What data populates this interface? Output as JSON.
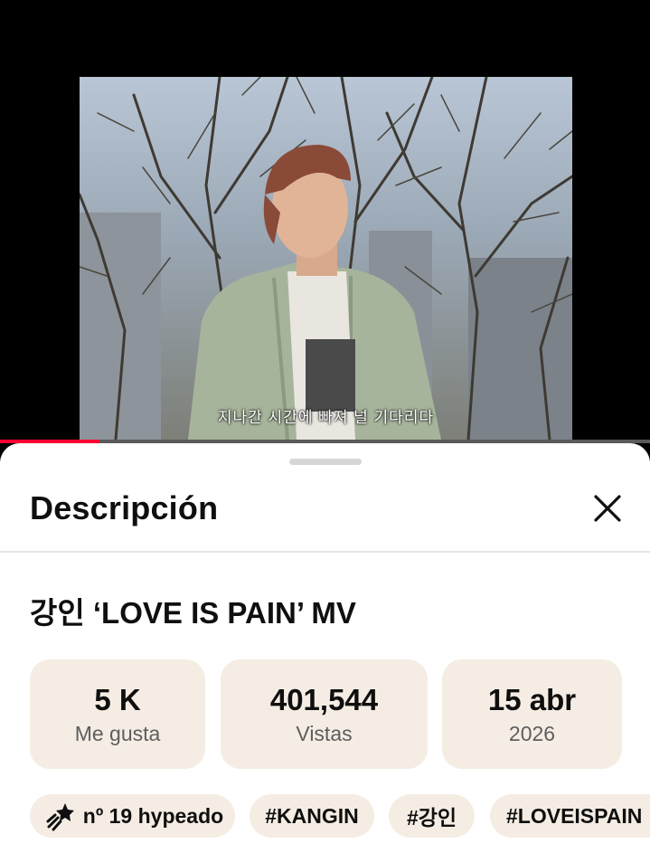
{
  "video": {
    "subtitle": "지나간 시간에 빠져 널 기다리다",
    "progress_fraction": 0.153
  },
  "sheet": {
    "title": "Descripción",
    "close_icon": "close-icon"
  },
  "description": {
    "video_title": "강인 ‘LOVE IS PAIN’ MV",
    "stats": [
      {
        "value": "5 K",
        "label": "Me gusta"
      },
      {
        "value": "401,544",
        "label": "Vistas"
      },
      {
        "value": "15 abr",
        "label": "2026"
      }
    ],
    "chips": [
      {
        "label": "nº 19 hypeado",
        "icon": "hype-rocket-icon"
      },
      {
        "label": "#KANGIN"
      },
      {
        "label": "#강인"
      },
      {
        "label": "#LOVEISPAIN"
      }
    ]
  },
  "colors": {
    "progress": "#ff0033",
    "card_bg": "#f5ede3",
    "text": "#0f0f0f",
    "secondary_text": "#5e5e5e"
  }
}
